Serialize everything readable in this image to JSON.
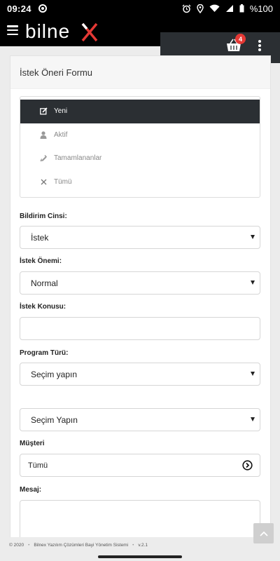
{
  "status_bar": {
    "time": "09:24",
    "battery": "%100"
  },
  "header": {
    "logo_text": "bilnex",
    "cart_badge": "4"
  },
  "form": {
    "title": "İstek Öneri Formu",
    "tabs": [
      {
        "label": "Yeni",
        "icon": "edit-icon",
        "active": true
      },
      {
        "label": "Aktif",
        "icon": "user-icon",
        "active": false
      },
      {
        "label": "Tamamlananlar",
        "icon": "pen-icon",
        "active": false
      },
      {
        "label": "Tümü",
        "icon": "close-icon",
        "active": false
      }
    ],
    "bildirim_cinsi": {
      "label": "Bildirim Cinsi:",
      "value": "İstek"
    },
    "istek_onemi": {
      "label": "İstek Önemi:",
      "value": "Normal"
    },
    "istek_konusu": {
      "label": "İstek Konusu:",
      "value": ""
    },
    "program_turu": {
      "label": "Program Türü:",
      "value": "Seçim yapın"
    },
    "secim": {
      "value": "Seçim Yapın"
    },
    "musteri": {
      "label": "Müşteri",
      "value": "Tümü"
    },
    "mesaj": {
      "label": "Mesaj:",
      "value": ""
    }
  },
  "footer": {
    "copyright": "© 2020",
    "company": "Bilnex Yazılım Çözümleri Bayi Yönetim Sistemi",
    "version": "v.2.1"
  },
  "colors": {
    "dark": "#2b2f33",
    "badge": "#e53935",
    "logo_accent": "#e53935"
  }
}
